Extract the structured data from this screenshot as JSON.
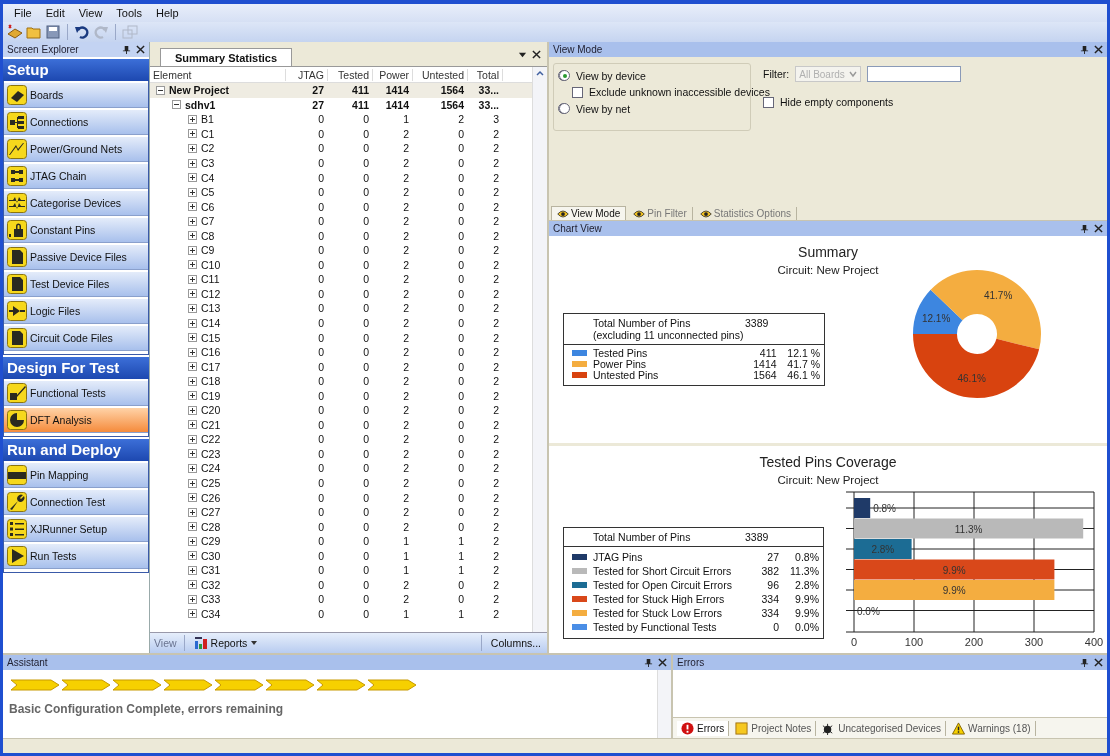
{
  "menu": [
    "File",
    "Edit",
    "View",
    "Tools",
    "Help"
  ],
  "explorer": {
    "title": "Screen Explorer",
    "sections": [
      {
        "title": "Setup",
        "items": [
          {
            "label": "Boards",
            "selected": false
          },
          {
            "label": "Connections",
            "selected": false
          },
          {
            "label": "Power/Ground Nets",
            "selected": false
          },
          {
            "label": "JTAG Chain",
            "selected": false
          },
          {
            "label": "Categorise Devices",
            "selected": false
          },
          {
            "label": "Constant Pins",
            "selected": false
          },
          {
            "label": "Passive Device Files",
            "selected": false
          },
          {
            "label": "Test Device Files",
            "selected": false
          },
          {
            "label": "Logic Files",
            "selected": false
          },
          {
            "label": "Circuit Code Files",
            "selected": false
          }
        ]
      },
      {
        "title": "Design For Test",
        "items": [
          {
            "label": "Functional Tests",
            "selected": false
          },
          {
            "label": "DFT Analysis",
            "selected": true
          }
        ]
      },
      {
        "title": "Run and Deploy",
        "items": [
          {
            "label": "Pin Mapping",
            "selected": false
          },
          {
            "label": "Connection Test",
            "selected": false
          },
          {
            "label": "XJRunner Setup",
            "selected": false
          },
          {
            "label": "Run Tests",
            "selected": false
          }
        ]
      }
    ]
  },
  "summary": {
    "tab": "Summary Statistics",
    "columns": [
      "Element",
      "JTAG",
      "Tested",
      "Power",
      "Untested",
      "Total"
    ],
    "rows": [
      {
        "expanded": true,
        "cells": [
          "New Project",
          "27",
          "411",
          "1414",
          "1564",
          "33..."
        ],
        "children": [
          {
            "expanded": true,
            "cells": [
              "sdhv1",
              "27",
              "411",
              "1414",
              "1564",
              "33..."
            ],
            "children": [
              {
                "expanded": false,
                "cells": [
                  "B1",
                  "0",
                  "0",
                  "1",
                  "2",
                  "3"
                ]
              },
              {
                "expanded": false,
                "cells": [
                  "C1",
                  "0",
                  "0",
                  "2",
                  "0",
                  "2"
                ]
              },
              {
                "expanded": false,
                "cells": [
                  "C2",
                  "0",
                  "0",
                  "2",
                  "0",
                  "2"
                ]
              },
              {
                "expanded": false,
                "cells": [
                  "C3",
                  "0",
                  "0",
                  "2",
                  "0",
                  "2"
                ]
              },
              {
                "expanded": false,
                "cells": [
                  "C4",
                  "0",
                  "0",
                  "2",
                  "0",
                  "2"
                ]
              },
              {
                "expanded": false,
                "cells": [
                  "C5",
                  "0",
                  "0",
                  "2",
                  "0",
                  "2"
                ]
              },
              {
                "expanded": false,
                "cells": [
                  "C6",
                  "0",
                  "0",
                  "2",
                  "0",
                  "2"
                ]
              },
              {
                "expanded": false,
                "cells": [
                  "C7",
                  "0",
                  "0",
                  "2",
                  "0",
                  "2"
                ]
              },
              {
                "expanded": false,
                "cells": [
                  "C8",
                  "0",
                  "0",
                  "2",
                  "0",
                  "2"
                ]
              },
              {
                "expanded": false,
                "cells": [
                  "C9",
                  "0",
                  "0",
                  "2",
                  "0",
                  "2"
                ]
              },
              {
                "expanded": false,
                "cells": [
                  "C10",
                  "0",
                  "0",
                  "2",
                  "0",
                  "2"
                ]
              },
              {
                "expanded": false,
                "cells": [
                  "C11",
                  "0",
                  "0",
                  "2",
                  "0",
                  "2"
                ]
              },
              {
                "expanded": false,
                "cells": [
                  "C12",
                  "0",
                  "0",
                  "2",
                  "0",
                  "2"
                ]
              },
              {
                "expanded": false,
                "cells": [
                  "C13",
                  "0",
                  "0",
                  "2",
                  "0",
                  "2"
                ]
              },
              {
                "expanded": false,
                "cells": [
                  "C14",
                  "0",
                  "0",
                  "2",
                  "0",
                  "2"
                ]
              },
              {
                "expanded": false,
                "cells": [
                  "C15",
                  "0",
                  "0",
                  "2",
                  "0",
                  "2"
                ]
              },
              {
                "expanded": false,
                "cells": [
                  "C16",
                  "0",
                  "0",
                  "2",
                  "0",
                  "2"
                ]
              },
              {
                "expanded": false,
                "cells": [
                  "C17",
                  "0",
                  "0",
                  "2",
                  "0",
                  "2"
                ]
              },
              {
                "expanded": false,
                "cells": [
                  "C18",
                  "0",
                  "0",
                  "2",
                  "0",
                  "2"
                ]
              },
              {
                "expanded": false,
                "cells": [
                  "C19",
                  "0",
                  "0",
                  "2",
                  "0",
                  "2"
                ]
              },
              {
                "expanded": false,
                "cells": [
                  "C20",
                  "0",
                  "0",
                  "2",
                  "0",
                  "2"
                ]
              },
              {
                "expanded": false,
                "cells": [
                  "C21",
                  "0",
                  "0",
                  "2",
                  "0",
                  "2"
                ]
              },
              {
                "expanded": false,
                "cells": [
                  "C22",
                  "0",
                  "0",
                  "2",
                  "0",
                  "2"
                ]
              },
              {
                "expanded": false,
                "cells": [
                  "C23",
                  "0",
                  "0",
                  "2",
                  "0",
                  "2"
                ]
              },
              {
                "expanded": false,
                "cells": [
                  "C24",
                  "0",
                  "0",
                  "2",
                  "0",
                  "2"
                ]
              },
              {
                "expanded": false,
                "cells": [
                  "C25",
                  "0",
                  "0",
                  "2",
                  "0",
                  "2"
                ]
              },
              {
                "expanded": false,
                "cells": [
                  "C26",
                  "0",
                  "0",
                  "2",
                  "0",
                  "2"
                ]
              },
              {
                "expanded": false,
                "cells": [
                  "C27",
                  "0",
                  "0",
                  "2",
                  "0",
                  "2"
                ]
              },
              {
                "expanded": false,
                "cells": [
                  "C28",
                  "0",
                  "0",
                  "2",
                  "0",
                  "2"
                ]
              },
              {
                "expanded": false,
                "cells": [
                  "C29",
                  "0",
                  "0",
                  "1",
                  "1",
                  "2"
                ]
              },
              {
                "expanded": false,
                "cells": [
                  "C30",
                  "0",
                  "0",
                  "1",
                  "1",
                  "2"
                ]
              },
              {
                "expanded": false,
                "cells": [
                  "C31",
                  "0",
                  "0",
                  "1",
                  "1",
                  "2"
                ]
              },
              {
                "expanded": false,
                "cells": [
                  "C32",
                  "0",
                  "0",
                  "2",
                  "0",
                  "2"
                ]
              },
              {
                "expanded": false,
                "cells": [
                  "C33",
                  "0",
                  "0",
                  "2",
                  "0",
                  "2"
                ]
              },
              {
                "expanded": false,
                "cells": [
                  "C34",
                  "0",
                  "0",
                  "1",
                  "1",
                  "2"
                ]
              }
            ]
          }
        ]
      }
    ],
    "footer": {
      "view": {
        "label": "View",
        "disabled": true
      },
      "reports": "Reports",
      "columns": "Columns..."
    }
  },
  "view_mode": {
    "title": "View Mode",
    "options": [
      {
        "kind": "radio",
        "label": "View by device",
        "selected": true
      },
      {
        "kind": "checkbox",
        "label": "Exclude unknown inaccessible devices",
        "checked": false
      },
      {
        "kind": "radio",
        "label": "View by net",
        "selected": false
      }
    ],
    "filter_label": "Filter:",
    "filter_select": {
      "value": "All Boards",
      "disabled": true
    },
    "hide_empty": {
      "label": "Hide empty components",
      "checked": false
    },
    "tabs": [
      {
        "label": "View Mode",
        "selected": true
      },
      {
        "label": "Pin Filter",
        "selected": false
      },
      {
        "label": "Statistics Options",
        "selected": false
      }
    ]
  },
  "chart_view": {
    "title": "Chart View",
    "summary": {
      "title": "Summary",
      "subtitle": "Circuit: New Project",
      "total_label": "Total Number of Pins",
      "total_note": "(excluding 11 unconnected pins)",
      "total": "3389",
      "legend": [
        {
          "label": "Tested Pins",
          "color": "#3d86e0",
          "count": "411",
          "percent": "12.1 %"
        },
        {
          "label": "Power Pins",
          "color": "#f4ad40",
          "count": "1414",
          "percent": "41.7 %"
        },
        {
          "label": "Untested Pins",
          "color": "#d8430f",
          "count": "1564",
          "percent": "46.1 %"
        }
      ],
      "chart_data": {
        "type": "donut",
        "values": [
          12.1,
          41.7,
          46.1
        ],
        "value_labels": [
          "12.1%",
          "41.7%",
          "46.1%"
        ]
      }
    },
    "coverage": {
      "title": "Tested Pins Coverage",
      "subtitle": "Circuit: New Project",
      "total_label": "Total Number of Pins",
      "total": "3389",
      "legend": [
        {
          "label": "JTAG Pins",
          "color": "#1f3a68",
          "count": "27",
          "percent": "0.8%"
        },
        {
          "label": "Tested for Short Circuit Errors",
          "color": "#b9b9b9",
          "count": "382",
          "percent": "11.3%"
        },
        {
          "label": "Tested for Open Circuit Errors",
          "color": "#1c6c94",
          "count": "96",
          "percent": "2.8%"
        },
        {
          "label": "Tested for Stuck High Errors",
          "color": "#d9481a",
          "count": "334",
          "percent": "9.9%"
        },
        {
          "label": "Tested for Stuck Low Errors",
          "color": "#f4ad40",
          "count": "334",
          "percent": "9.9%"
        },
        {
          "label": "Tested by Functional Tests",
          "color": "#4a8ee6",
          "count": "0",
          "percent": "0.0%"
        }
      ],
      "bar_labels": [
        "0.8%",
        "11.3%",
        "2.8%",
        "9.9%",
        "9.9%",
        "0.0%"
      ],
      "chart_data": {
        "type": "bar",
        "orientation": "horizontal",
        "grid": true,
        "values": [
          27,
          382,
          96,
          334,
          334,
          0
        ],
        "xlim": [
          0,
          400
        ],
        "xticks": [
          0,
          100,
          200,
          300,
          400
        ]
      }
    }
  },
  "assistant": {
    "title": "Assistant",
    "message": "Basic Configuration Complete, errors remaining"
  },
  "errors": {
    "title": "Errors",
    "tabs": [
      {
        "label": "Errors",
        "selected": true
      },
      {
        "label": "Project Notes",
        "selected": false
      },
      {
        "label": "Uncategorised Devices",
        "selected": false
      },
      {
        "label": "Warnings (18)",
        "selected": false
      }
    ]
  }
}
